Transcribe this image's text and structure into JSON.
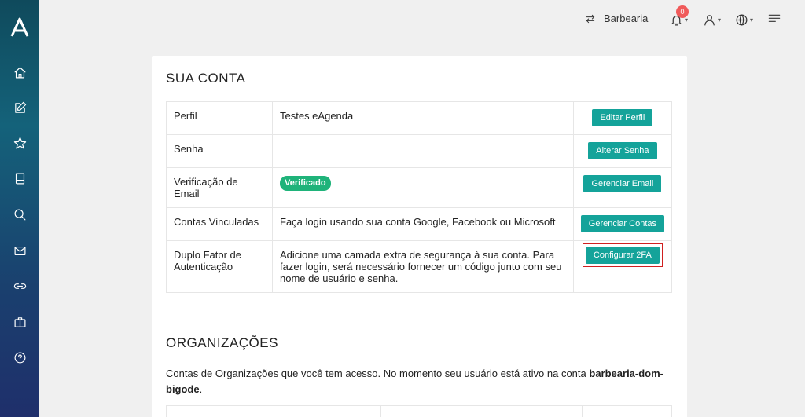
{
  "topbar": {
    "org_name": "Barbearia",
    "notification_count": "0",
    "caret": "▾"
  },
  "account": {
    "title": "SUA CONTA",
    "rows": [
      {
        "label": "Perfil",
        "value": "Testes eAgenda",
        "button": "Editar Perfil"
      },
      {
        "label": "Senha",
        "value": "",
        "button": "Alterar Senha"
      },
      {
        "label": "Verificação de Email",
        "badge": "Verificado",
        "button": "Gerenciar Email"
      },
      {
        "label": "Contas Vinculadas",
        "value": "Faça login usando sua conta Google, Facebook ou Microsoft",
        "button": "Gerenciar Contas"
      },
      {
        "label": "Duplo Fator de Autenticação",
        "value": "Adicione uma camada extra de segurança à sua conta. Para fazer login, será necessário fornecer um código junto com seu nome de usuário e senha.",
        "button": "Configurar 2FA"
      }
    ]
  },
  "organizations": {
    "title": "ORGANIZAÇÕES",
    "description": "Contas de Organizações que você tem acesso. No momento seu usuário está ativo na conta",
    "active_account": "barbearia-dom-bigode",
    "period": "."
  },
  "colors": {
    "accent": "#14a39a",
    "verified": "#1fb37a",
    "badge": "#f05a5a",
    "highlight": "#d02020"
  }
}
